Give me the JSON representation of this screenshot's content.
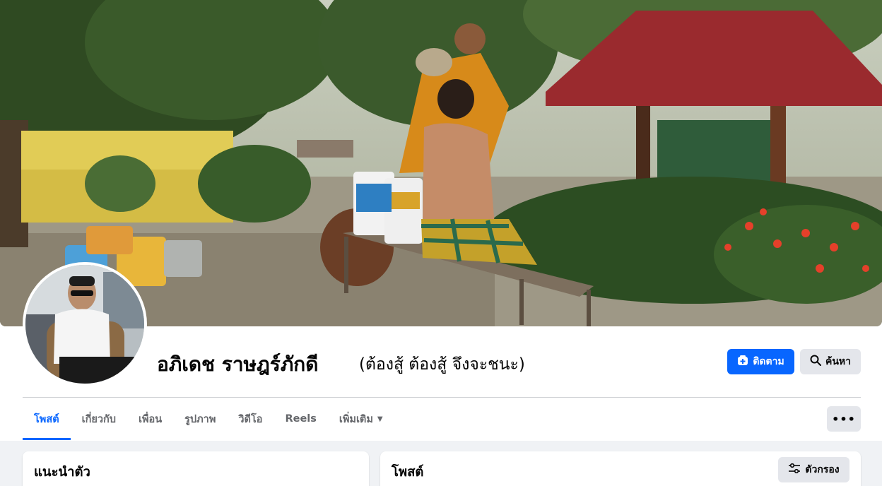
{
  "profile": {
    "name": "อภิเดช ราษฎร์ภักดี",
    "alternate_name": "(ต้องสู้ ต้องสู้ จึงจะชนะ)"
  },
  "actions": {
    "follow_label": "ติดตาม",
    "search_label": "ค้นหา",
    "more_label": "•••"
  },
  "tabs": [
    {
      "label": "โพสต์",
      "active": true
    },
    {
      "label": "เกี่ยวกับ"
    },
    {
      "label": "เพื่อน"
    },
    {
      "label": "รูปภาพ"
    },
    {
      "label": "วิดีโอ"
    },
    {
      "label": "Reels"
    },
    {
      "label": "เพิ่มเติม"
    }
  ],
  "intro": {
    "title": "แนะนำตัว"
  },
  "posts": {
    "title": "โพสต์",
    "filter_label": "ตัวกรอง"
  },
  "colors": {
    "accent": "#0866ff",
    "secondary_button": "#e4e6eb",
    "page_bg": "#f0f2f5"
  },
  "icons": [
    "follow-icon",
    "search-icon",
    "chevron-down-icon",
    "more-icon",
    "filter-icon"
  ]
}
